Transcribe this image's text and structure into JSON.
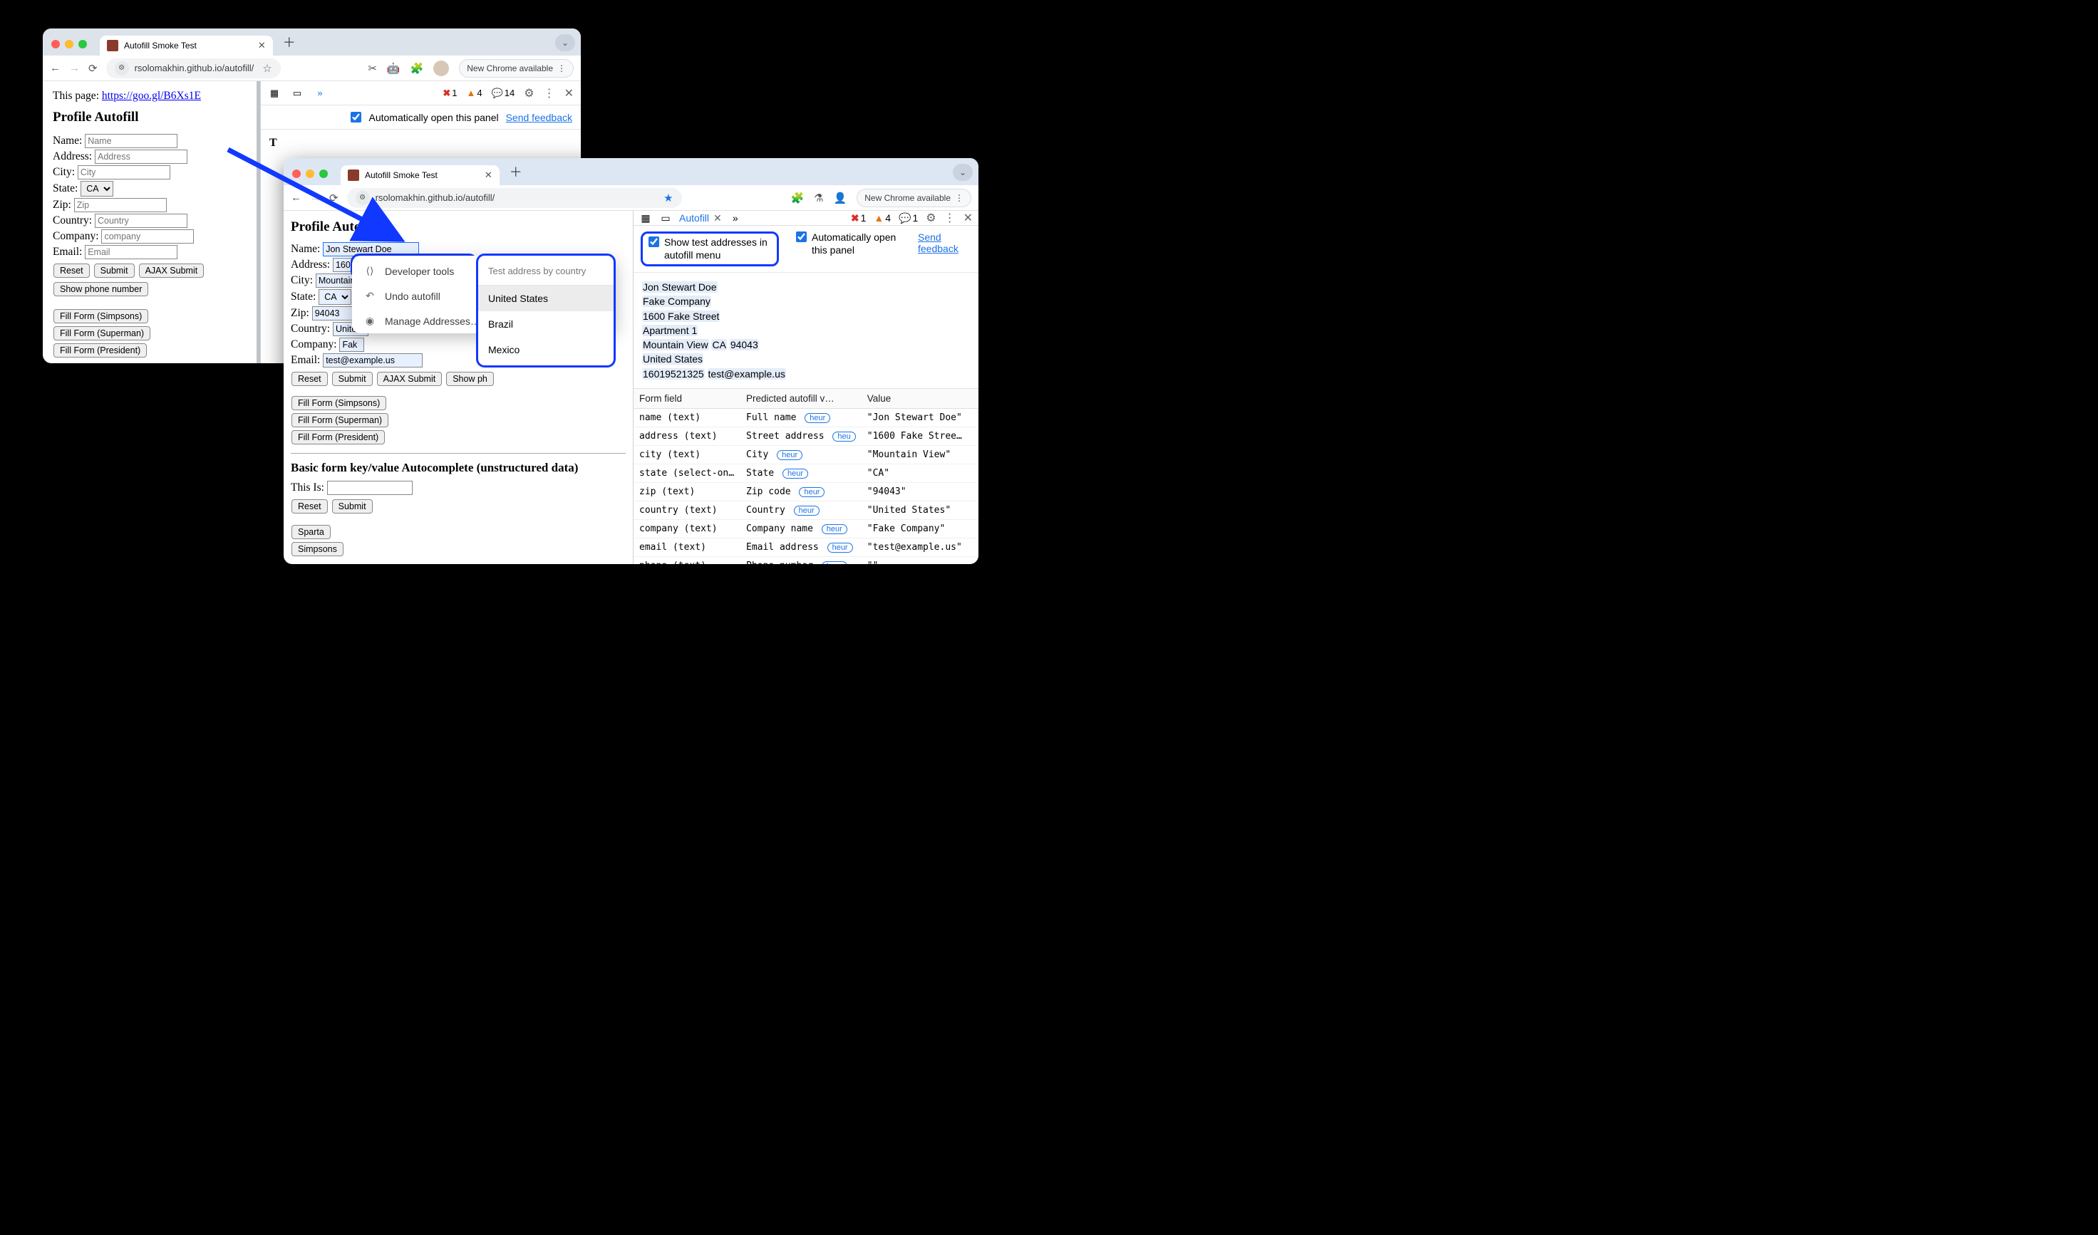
{
  "win1": {
    "tab_title": "Autofill Smoke Test",
    "url": "rsolomakhin.github.io/autofill/",
    "update_button": "New Chrome available",
    "devtools": {
      "errors": "1",
      "warnings": "4",
      "messages": "14",
      "auto_open_label": "Automatically open this panel",
      "feedback_link": "Send feedback",
      "partial_label": "T"
    },
    "page": {
      "thispage_label": "This page:",
      "thispage_link": "https://goo.gl/B6Xs1E",
      "heading": "Profile Autofill",
      "labels": {
        "name": "Name:",
        "address": "Address:",
        "city": "City:",
        "state": "State:",
        "zip": "Zip:",
        "country": "Country:",
        "company": "Company:",
        "email": "Email:"
      },
      "placeholders": {
        "name": "Name",
        "address": "Address",
        "city": "City",
        "zip": "Zip",
        "country": "Country",
        "company": "company",
        "email": "Email"
      },
      "state_value": "CA",
      "buttons": [
        "Reset",
        "Submit",
        "AJAX Submit"
      ],
      "show_phone": "Show phone number",
      "fillers": [
        "Fill Form (Simpsons)",
        "Fill Form (Superman)",
        "Fill Form (President)"
      ]
    }
  },
  "win2": {
    "tab_title": "Autofill Smoke Test",
    "url": "rsolomakhin.github.io/autofill/",
    "update_button": "New Chrome available",
    "page": {
      "heading": "Profile Autofill",
      "labels": {
        "name": "Name:",
        "address": "Address:",
        "city": "City:",
        "state": "State:",
        "zip": "Zip:",
        "country": "Country:",
        "company": "Company:",
        "email": "Email:",
        "thisis": "This Is:"
      },
      "values": {
        "name": "Jon Stewart Doe",
        "address": "1600 F",
        "city": "Mountain",
        "state": "CA",
        "zip": "94043",
        "country": "United",
        "company": "Fak",
        "email": "test@example.us"
      },
      "buttons": [
        "Reset",
        "Submit",
        "AJAX Submit",
        "Show ph"
      ],
      "fillers": [
        "Fill Form (Simpsons)",
        "Fill Form (Superman)",
        "Fill Form (President)"
      ],
      "basic_heading": "Basic form key/value Autocomplete (unstructured data)",
      "basic_buttons": [
        "Reset",
        "Submit"
      ],
      "basic_fillers": [
        "Sparta",
        "Simpsons"
      ]
    },
    "popup": {
      "dev_tools": "Developer tools",
      "undo": "Undo autofill",
      "manage": "Manage Addresses…",
      "country_header": "Test address by country",
      "countries": [
        "United States",
        "Brazil",
        "Mexico"
      ]
    },
    "dev": {
      "tab": "Autofill",
      "errors": "1",
      "warnings": "4",
      "messages": "1",
      "opt1": "Show test addresses in autofill menu",
      "opt2": "Automatically open this panel",
      "feedback": "Send feedback",
      "address_lines": [
        "Jon Stewart Doe",
        "Fake Company",
        "1600 Fake Street",
        "Apartment 1",
        "Mountain View CA 94043",
        "United States",
        "16019521325 test@example.us"
      ],
      "cols": [
        "Form field",
        "Predicted autofill v…",
        "Value"
      ],
      "rows": [
        {
          "f": "name (text)",
          "p": "Full name",
          "h": "heur",
          "v": "\"Jon Stewart Doe\""
        },
        {
          "f": "address (text)",
          "p": "Street address",
          "h": "heu",
          "v": "\"1600 Fake Stree…"
        },
        {
          "f": "city (text)",
          "p": "City",
          "h": "heur",
          "v": "\"Mountain View\""
        },
        {
          "f": "state (select-on…",
          "p": "State",
          "h": "heur",
          "v": "\"CA\""
        },
        {
          "f": "zip (text)",
          "p": "Zip code",
          "h": "heur",
          "v": "\"94043\""
        },
        {
          "f": "country (text)",
          "p": "Country",
          "h": "heur",
          "v": "\"United States\""
        },
        {
          "f": "company (text)",
          "p": "Company name",
          "h": "heur",
          "v": "\"Fake Company\""
        },
        {
          "f": "email (text)",
          "p": "Email address",
          "h": "heur",
          "v": "\"test@example.us\""
        },
        {
          "f": "phone (text)",
          "p": "Phone number",
          "h": "heur",
          "v": "\"\""
        }
      ]
    }
  }
}
